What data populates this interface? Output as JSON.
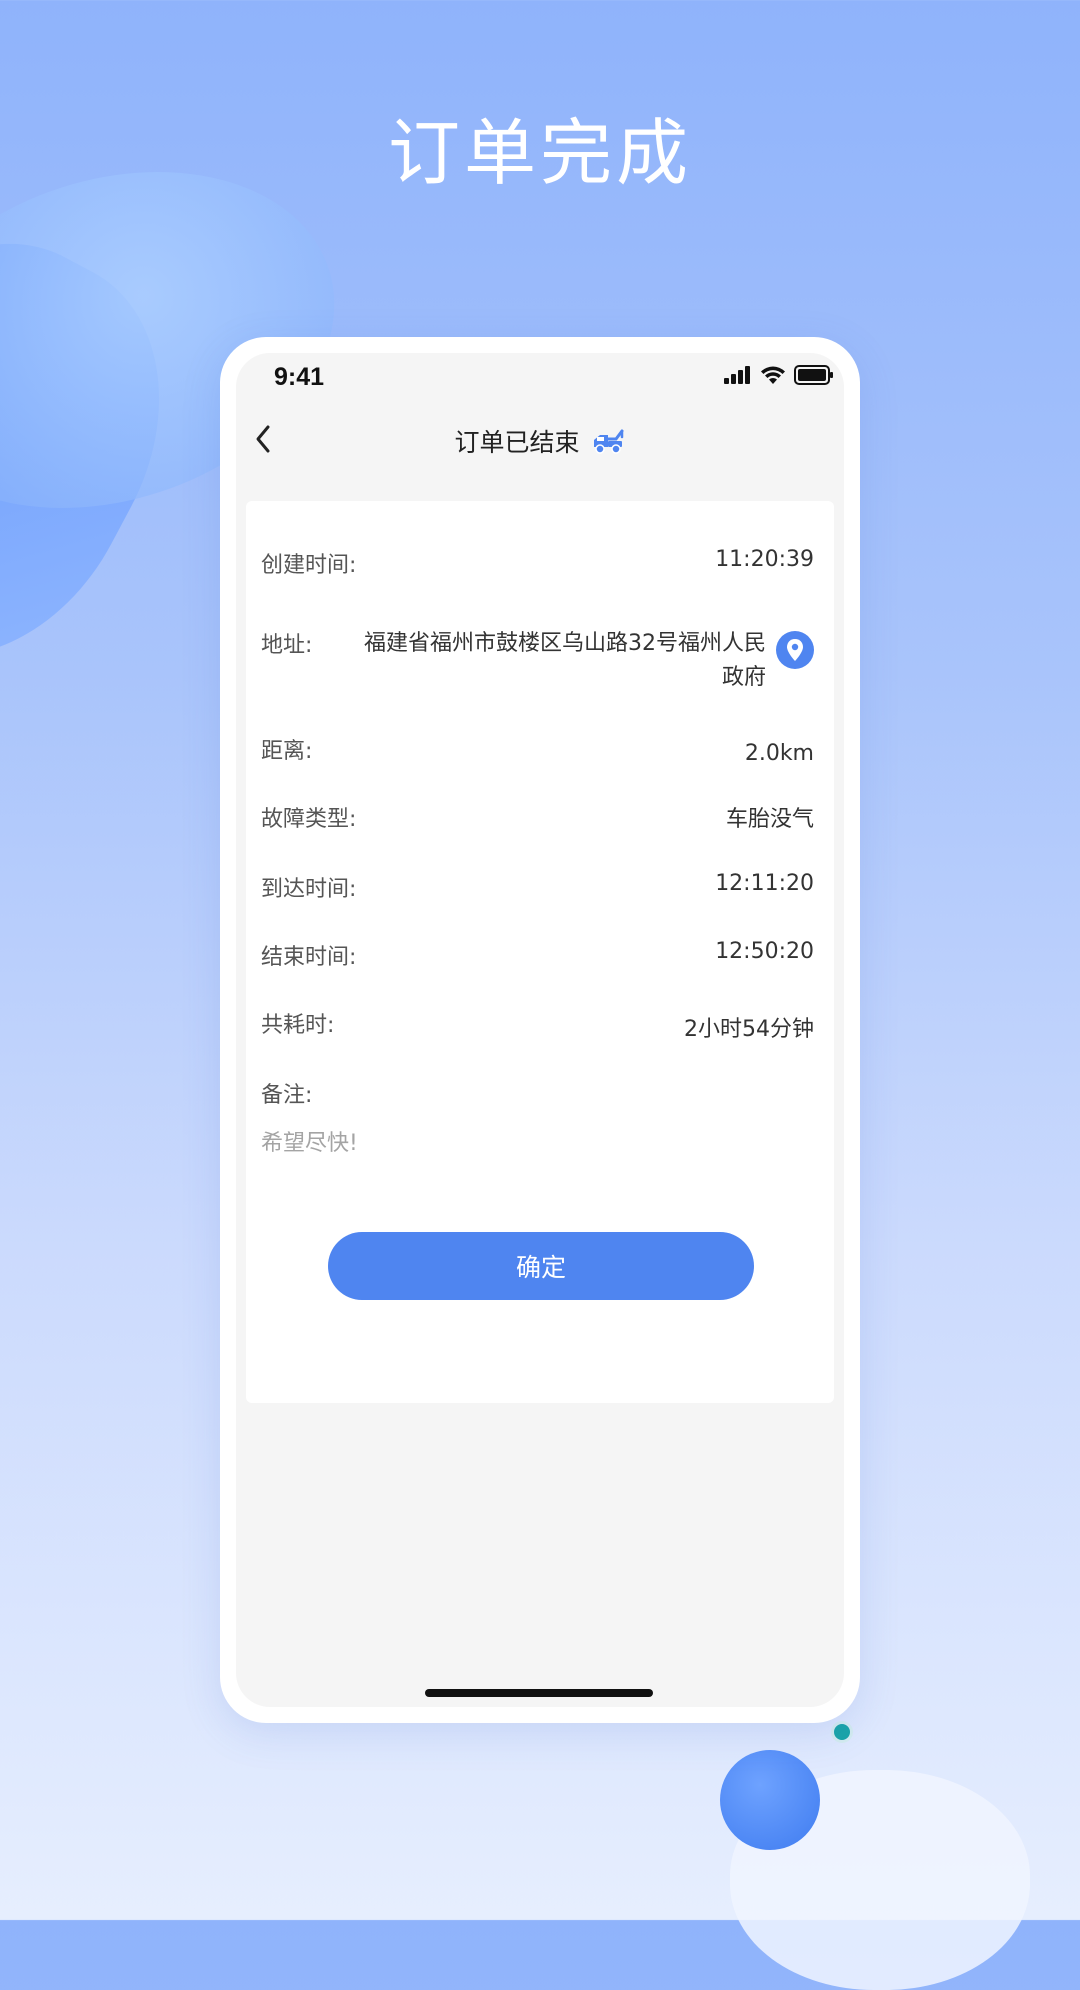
{
  "hero": {
    "title": "订单完成"
  },
  "status_bar": {
    "time": "9:41"
  },
  "nav": {
    "title": "订单已结束"
  },
  "order": {
    "created_label": "创建时间:",
    "created_value": "11:20:39",
    "address_label": "地址:",
    "address_value": "福建省福州市鼓楼区乌山路32号福州人民政府",
    "distance_label": "距离:",
    "distance_value": "2.0km",
    "fault_label": "故障类型:",
    "fault_value": "车胎没气",
    "arrive_label": "到达时间:",
    "arrive_value": "12:11:20",
    "end_label": "结束时间:",
    "end_value": "12:50:20",
    "duration_label": "共耗时:",
    "duration_value": "2小时54分钟",
    "note_label": "备注:",
    "note_value": "希望尽快!"
  },
  "confirm_label": "确定",
  "colors": {
    "accent": "#4f85f0",
    "card": "#ffffff",
    "screen_bg": "#f5f5f5"
  },
  "icons": {
    "back": "chevron-left-icon",
    "nav": "tow-truck-icon",
    "location": "location-pin-icon"
  }
}
